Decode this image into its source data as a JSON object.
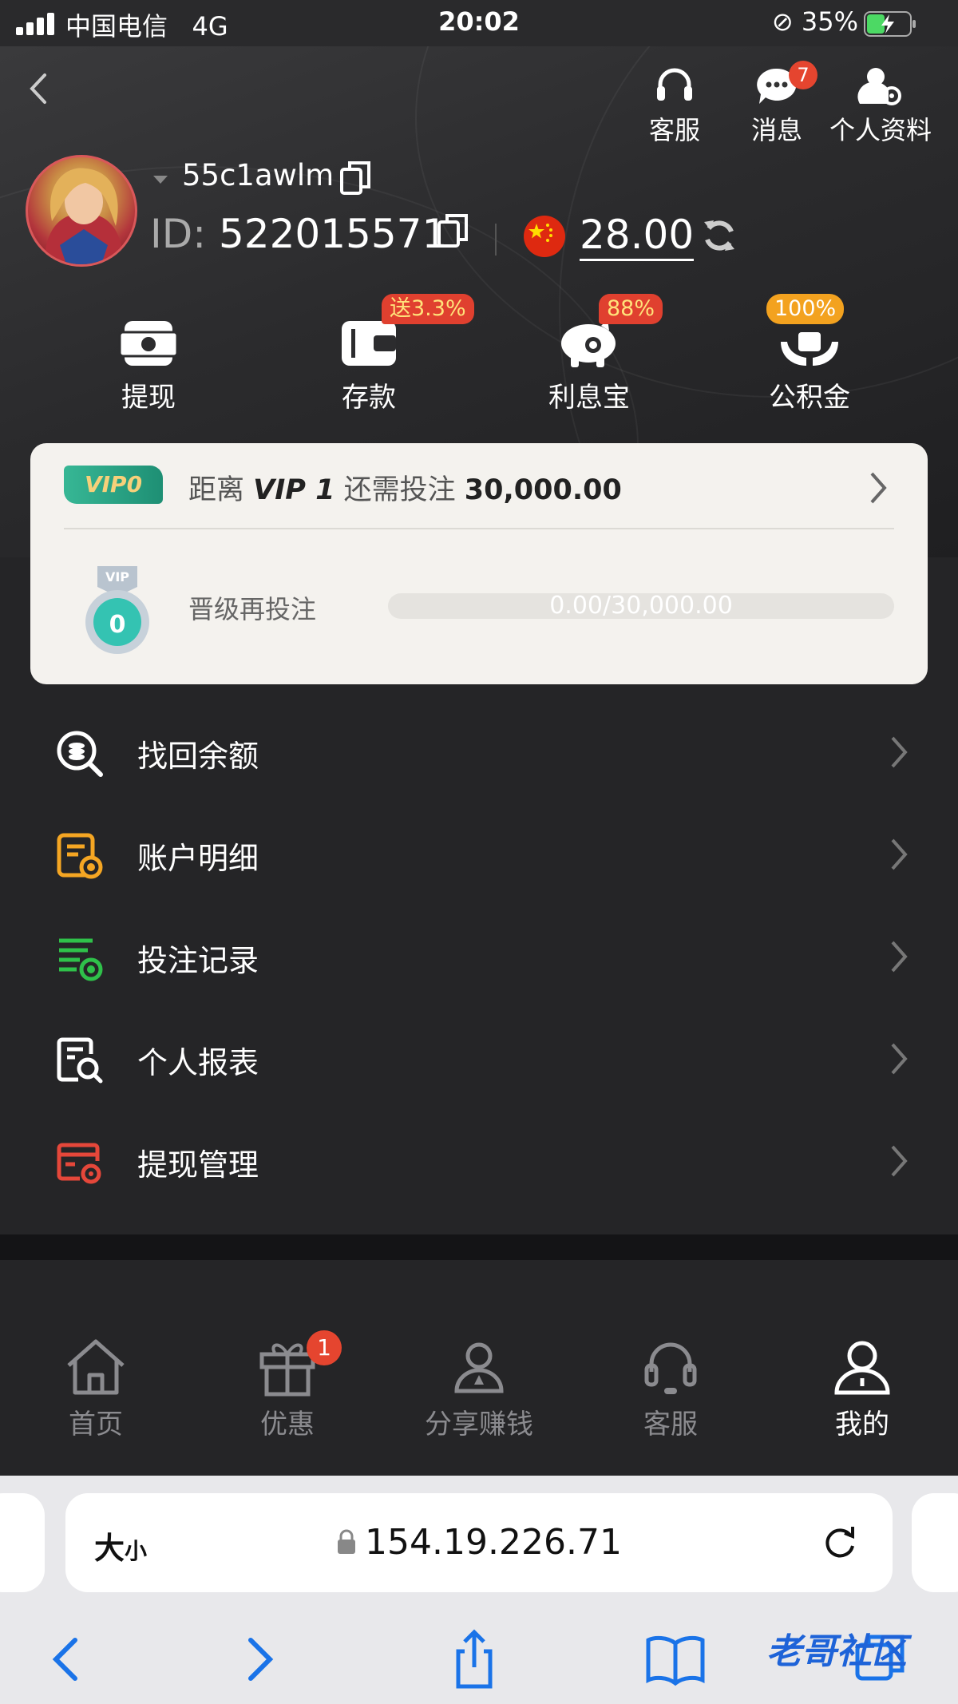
{
  "status": {
    "carrier": "中国电信",
    "network": "4G",
    "time": "20:02",
    "battery": "35%"
  },
  "header": {
    "top_icons": [
      {
        "label": "客服",
        "icon": "headset-icon"
      },
      {
        "label": "消息",
        "icon": "chat-icon",
        "badge": "7"
      },
      {
        "label": "个人资料",
        "icon": "user-settings-icon"
      }
    ],
    "username": "55c1awlm",
    "id_label": "ID:",
    "id_value": "522015571",
    "balance": "28.00",
    "actions": [
      {
        "label": "提现",
        "icon": "withdraw-icon"
      },
      {
        "label": "存款",
        "icon": "wallet-icon",
        "badge": "送3.3%"
      },
      {
        "label": "利息宝",
        "icon": "piggy-bank-icon",
        "badge": "88%"
      },
      {
        "label": "公积金",
        "icon": "hands-money-icon",
        "badge": "100%"
      }
    ]
  },
  "vip": {
    "level_badge": "VIP0",
    "line_prefix": "距离",
    "next_level": "VIP 1",
    "line_middle": "还需投注",
    "amount": "30,000.00",
    "medal_number": "0",
    "medal_tag": "VIP",
    "upgrade_label": "晋级再投注",
    "progress_text": "0.00/30,000.00",
    "progress": 0
  },
  "menu": [
    {
      "label": "找回余额",
      "icon": "coin-search-icon",
      "color": "#ffffff"
    },
    {
      "label": "账户明细",
      "icon": "account-detail-icon",
      "color": "#f5a623"
    },
    {
      "label": "投注记录",
      "icon": "bet-record-icon",
      "color": "#2fc14a"
    },
    {
      "label": "个人报表",
      "icon": "report-search-icon",
      "color": "#ffffff"
    },
    {
      "label": "提现管理",
      "icon": "withdraw-manage-icon",
      "color": "#e5473a"
    }
  ],
  "tabs": [
    {
      "label": "首页",
      "icon": "home-icon"
    },
    {
      "label": "优惠",
      "icon": "gift-icon",
      "badge": "1"
    },
    {
      "label": "分享赚钱",
      "icon": "share-people-icon"
    },
    {
      "label": "客服",
      "icon": "headset-icon"
    },
    {
      "label": "我的",
      "icon": "profile-icon",
      "active": true
    }
  ],
  "browser": {
    "text_size_big": "大",
    "text_size_small": "小",
    "url": "154.19.226.71"
  },
  "watermark": "老哥社区"
}
